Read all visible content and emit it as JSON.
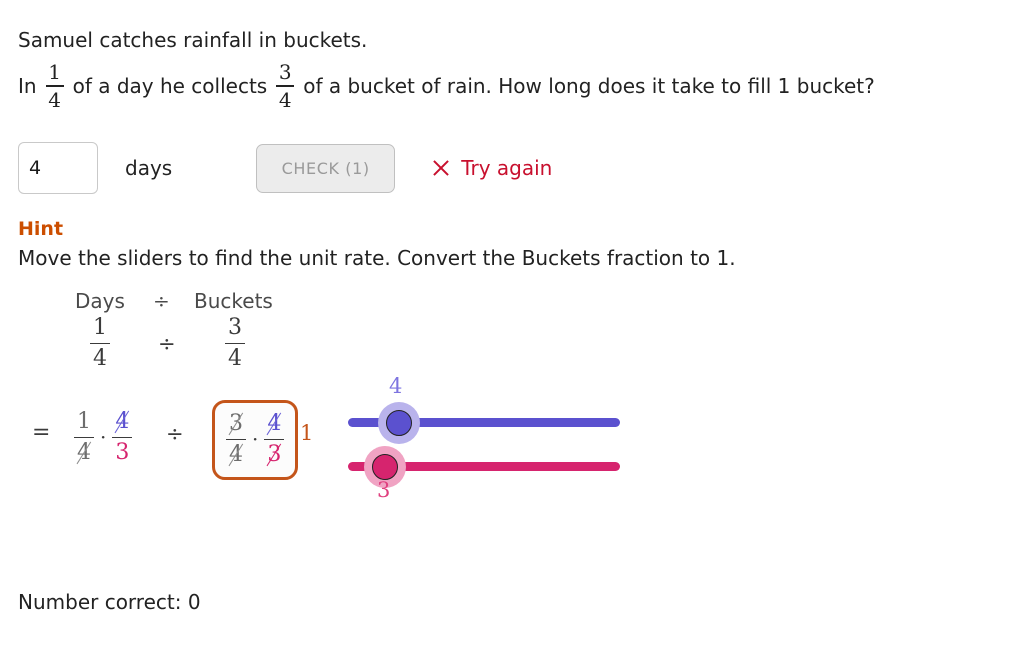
{
  "problem": {
    "line1": "Samuel catches rainfall in buckets.",
    "line2_prefix": "In",
    "fraction_days": {
      "num": "1",
      "den": "4"
    },
    "line2_middle": "of a day he collects",
    "fraction_buckets": {
      "num": "3",
      "den": "4"
    },
    "line2_suffix": "of a bucket of rain. How long does it take to fill 1 bucket?"
  },
  "answer": {
    "value": "4",
    "placeholder": "",
    "units": "days",
    "check_label": "CHECK (1)",
    "feedback": "Try again",
    "feedback_icon": "x-mark-icon",
    "feedback_color": "#c8102e"
  },
  "hint": {
    "title": "Hint",
    "title_color": "#cc4e00",
    "text": "Move the sliders to find the unit rate. Convert the Buckets fraction to 1."
  },
  "work": {
    "label_days": "Days",
    "label_divide": "÷",
    "label_buckets": "Buckets",
    "top_days": {
      "num": "1",
      "den": "4"
    },
    "top_divide": "÷",
    "top_buckets": {
      "num": "3",
      "den": "4"
    },
    "equals": "=",
    "dot": "·",
    "middle_divide": "÷",
    "left_pair": {
      "frac1": {
        "num": "1",
        "num_cancelled": false,
        "den": "4",
        "den_cancelled": true
      },
      "frac2": {
        "num": "4",
        "num_cancelled": true,
        "den": "3",
        "den_cancelled": false
      }
    },
    "boxed_pair": {
      "frac1": {
        "num": "3",
        "num_cancelled": true,
        "den": "4",
        "den_cancelled": true
      },
      "frac2": {
        "num": "4",
        "num_cancelled": true,
        "den": "3",
        "den_cancelled": true
      }
    },
    "box_border_color": "#c4551a",
    "result": "1",
    "result_color": "#c4551a"
  },
  "sliders": {
    "days": {
      "value": "4",
      "color": "#5b51cf",
      "halo_color": "#b9b3ec"
    },
    "buckets": {
      "value": "3",
      "color": "#d6246e",
      "halo_color": "#f0a3c3"
    }
  },
  "footer": {
    "score_label": "Number correct: 0"
  }
}
